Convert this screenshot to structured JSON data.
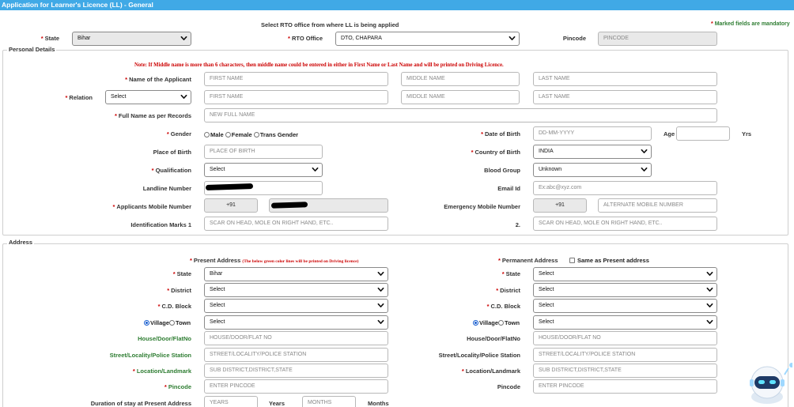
{
  "header": {
    "title": "Application for Learner's Licence (LL) - General"
  },
  "top": {
    "instruction": "Select RTO office from where LL is being applied",
    "mandatory_note": "Marked fields are mandatory",
    "state_label": "State",
    "state_value": "Bihar",
    "rto_label": "RTO Office",
    "rto_value": "DTO, CHAPARA",
    "pincode_label": "Pincode",
    "pincode_placeholder": "PINCODE"
  },
  "personal": {
    "legend": "Personal Details",
    "note": "Note: If Middle name is more than 6 characters, then middle name could be entered in either in First Name or Last Name and will be printed on Driving Licence.",
    "name_label": "Name of the Applicant",
    "first_ph": "FIRST NAME",
    "middle_ph": "MIDDLE NAME",
    "last_ph": "LAST NAME",
    "relation_label": "Relation",
    "relation_value": "Select",
    "full_name_label": "Full Name as per Records",
    "full_name_ph": "NEW FULL NAME",
    "gender_label": "Gender",
    "gender_options": [
      "Male",
      "Female",
      "Trans Gender"
    ],
    "dob_label": "Date of Birth",
    "dob_ph": "DD-MM-YYYY",
    "age_label": "Age",
    "age_unit": "Yrs",
    "pob_label": "Place of Birth",
    "pob_ph": "PLACE OF BIRTH",
    "country_label": "Country of Birth",
    "country_value": "INDIA",
    "qual_label": "Qualification",
    "qual_value": "Select",
    "blood_label": "Blood Group",
    "blood_value": "Unknown",
    "landline_label": "Landline Number",
    "email_label": "Email Id",
    "email_ph": "Ex:abc@xyz.com",
    "mobile_label": "Applicants Mobile Number",
    "mobile_code": "+91",
    "emergency_label": "Emergency Mobile Number",
    "emergency_code": "+91",
    "emergency_ph": "ALTERNATE MOBILE NUMBER",
    "idmark1_label": "Identification Marks 1",
    "idmark_ph": "SCAR ON HEAD, MOLE ON RIGHT HAND, ETC..",
    "idmark2_label": "2."
  },
  "address": {
    "legend": "Address",
    "present_label": "Present Address",
    "present_note": "(The below green color lines will be printed on Driving licence)",
    "permanent_label": "Permanent Address",
    "same_label": "Same as Present address",
    "state_label": "State",
    "present_state": "Bihar",
    "perm_state": "Select",
    "district_label": "District",
    "present_district": "Select",
    "perm_district": "Select",
    "cd_label": "C.D. Block",
    "present_cd": "Select",
    "perm_cd": "Select",
    "village_label": "Village",
    "town_label": "Town",
    "present_vt": "Select",
    "perm_vt": "Select",
    "house_label": "House/Door/FlatNo",
    "house_ph": "HOUSE/DOOR/FLAT NO",
    "street_label": "Street/Locality/Police Station",
    "street_ph": "STREET/LOCALITY/POLICE STATION",
    "location_label": "Location/Landmark",
    "location_ph": "SUB DISTRICT,DISTRICT,STATE",
    "pincode_label": "Pincode",
    "pincode_ph": "ENTER PINCODE",
    "duration_label": "Duration of stay at Present Address",
    "years_ph": "YEARS",
    "years_label": "Years",
    "months_ph": "MONTHS",
    "months_label": "Months"
  },
  "icons": {
    "dropdown": "chevron-down-icon",
    "chatbot": "robot-chatbot-icon"
  }
}
